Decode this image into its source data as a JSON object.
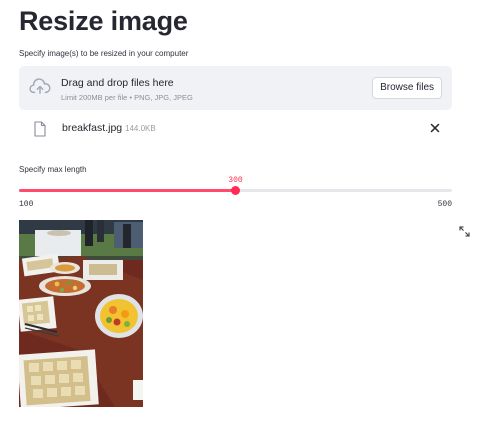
{
  "page": {
    "title": "Resize image"
  },
  "uploader": {
    "label": "Specify image(s) to be resized in your computer",
    "drop_title": "Drag and drop files here",
    "limit_text": "Limit 200MB per file • PNG, JPG, JPEG",
    "browse_label": "Browse files",
    "icon": "cloud-upload-icon"
  },
  "file": {
    "name": "breakfast.jpg",
    "size": "144.0KB",
    "icon": "file-icon",
    "remove_icon": "close-icon"
  },
  "slider": {
    "label": "Specify max length",
    "min": 100,
    "max": 500,
    "value": 300,
    "value_text": "300",
    "min_text": "100",
    "max_text": "500",
    "accent_color": "#ff2b55"
  },
  "image": {
    "fullscreen_icon": "expand-icon"
  },
  "colors": {
    "text": "#262730",
    "dropzone_bg": "#f0f2f6",
    "accent": "#ff2b55"
  }
}
